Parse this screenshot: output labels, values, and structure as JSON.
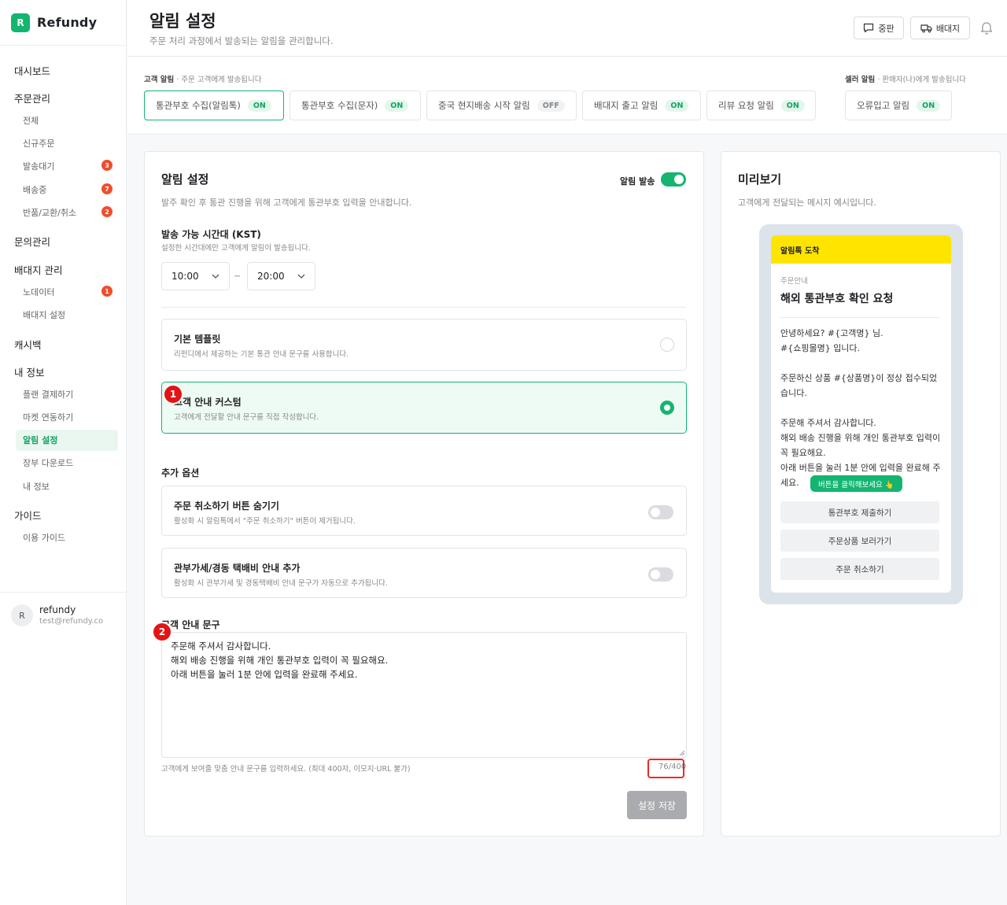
{
  "brand": {
    "logo_letter": "R",
    "name": "Refundy"
  },
  "nav": {
    "dashboard": "대시보드",
    "orders": "주문관리",
    "orders_all": "전체",
    "orders_new": "신규주문",
    "orders_pending": "발송대기",
    "orders_pending_badge": "3",
    "orders_shipping": "배송중",
    "orders_shipping_badge": "7",
    "orders_returns": "반품/교환/취소",
    "orders_returns_badge": "2",
    "inquiries": "문의관리",
    "forwarding": "배대지 관리",
    "forwarding_nodata": "노데이터",
    "forwarding_nodata_badge": "1",
    "forwarding_settings": "배대지 설정",
    "cashback": "캐시백",
    "myinfo": "내 정보",
    "plan_payment": "플랜 결제하기",
    "market_link": "마켓 연동하기",
    "alert_settings": "알림 설정",
    "ledger_download": "장부 다운로드",
    "my_info": "내 정보",
    "guide": "가이드",
    "usage_guide": "이용 가이드"
  },
  "user": {
    "avatar": "R",
    "name": "refundy",
    "email": "test@refundy.co"
  },
  "header": {
    "title": "알림 설정",
    "subtitle": "주문 처리 과정에서 발송되는 알림을 관리합니다.",
    "btn_market": "중판",
    "btn_forwarding": "배대지"
  },
  "tabs": {
    "customer_group": "고객 알림",
    "customer_group_hint": "· 주문 고객에게 발송됩니다",
    "seller_group": "셀러 알림",
    "seller_group_hint": "· 판매자(나)에게 발송됩니다",
    "items": [
      {
        "label": "통관부호 수집(알림톡)",
        "status": "ON"
      },
      {
        "label": "통관부호 수집(문자)",
        "status": "ON"
      },
      {
        "label": "중국 현지배송 시작 알림",
        "status": "OFF"
      },
      {
        "label": "배대지 출고 알림",
        "status": "ON"
      },
      {
        "label": "리뷰 요청 알림",
        "status": "ON"
      },
      {
        "label": "오류입고 알림",
        "status": "ON"
      }
    ]
  },
  "settings": {
    "title": "알림 설정",
    "desc": "발주 확인 후 통관 진행을 위해 고객에게 통관부호 입력을 안내합니다.",
    "send_toggle_label": "알림 발송",
    "send_toggle_on": true,
    "time_label": "발송 가능 시간대 (KST)",
    "time_hint": "설정한 시간대에만 고객에게 알림이 발송됩니다.",
    "time_from": "10:00",
    "time_to": "20:00",
    "tilde": "~",
    "template_default_title": "기본 템플릿",
    "template_default_desc": "리펀디에서 제공하는 기본 통관 안내 문구를 사용합니다.",
    "template_custom_title": "고객 안내 커스텀",
    "template_custom_desc": "고객에게 전달할 안내 문구를 직접 작성합니다.",
    "extra_label": "추가 옵션",
    "opt_hide_cancel_title": "주문 취소하기 버튼 숨기기",
    "opt_hide_cancel_desc": "활성화 시 알림톡에서 \"주문 취소하기\" 버튼이 제거됩니다.",
    "opt_hide_cancel_on": false,
    "opt_duty_title": "관부가세/경동 택배비 안내 추가",
    "opt_duty_desc": "활성화 시 관부가세 및 경동택배비 안내 문구가 자동으로 추가됩니다.",
    "opt_duty_on": false,
    "message_label": "고객 안내 문구",
    "message_text": "주문해 주셔서 감사합니다.\n해외 배송 진행을 위해 개인 통관부호 입력이 꼭 필요해요.\n아래 버튼을 눌러 1분 안에 입력을 완료해 주세요.",
    "message_hint": "고객에게 보여줄 맞춤 안내 문구를 입력하세요. (최대 400자, 이모지·URL 불가)",
    "message_count": "76/400",
    "save_label": "설정 저장",
    "marker_1": "1",
    "marker_2": "2"
  },
  "preview": {
    "title": "미리보기",
    "desc": "고객에게 전달되는 메시지 예시입니다.",
    "kakao_header": "알림톡 도착",
    "kicker": "주문안내",
    "headline": "해외 통관부호 확인 요청",
    "body": "안녕하세요? #{고객명} 님.\n#{쇼핑몰명} 입니다.\n\n주문하신 상품 #{상품명}이 정상 접수되었습니다.\n\n주문해 주셔서 감사합니다.\n해외 배송 진행을 위해 개인 통관부호 입력이 꼭 필요해요.\n아래 버튼을 눌러 1분 안에 입력을 완료해 주세요.",
    "tooltip": "버튼을 클릭해보세요 👆",
    "btn_submit": "통관부호 제출하기",
    "btn_view": "주문상품 보러가기",
    "btn_cancel": "주문 취소하기"
  },
  "colors": {
    "accent": "#13b571",
    "badge": "#ef4e2c",
    "kakao": "#fee500",
    "marker": "#e31414"
  }
}
